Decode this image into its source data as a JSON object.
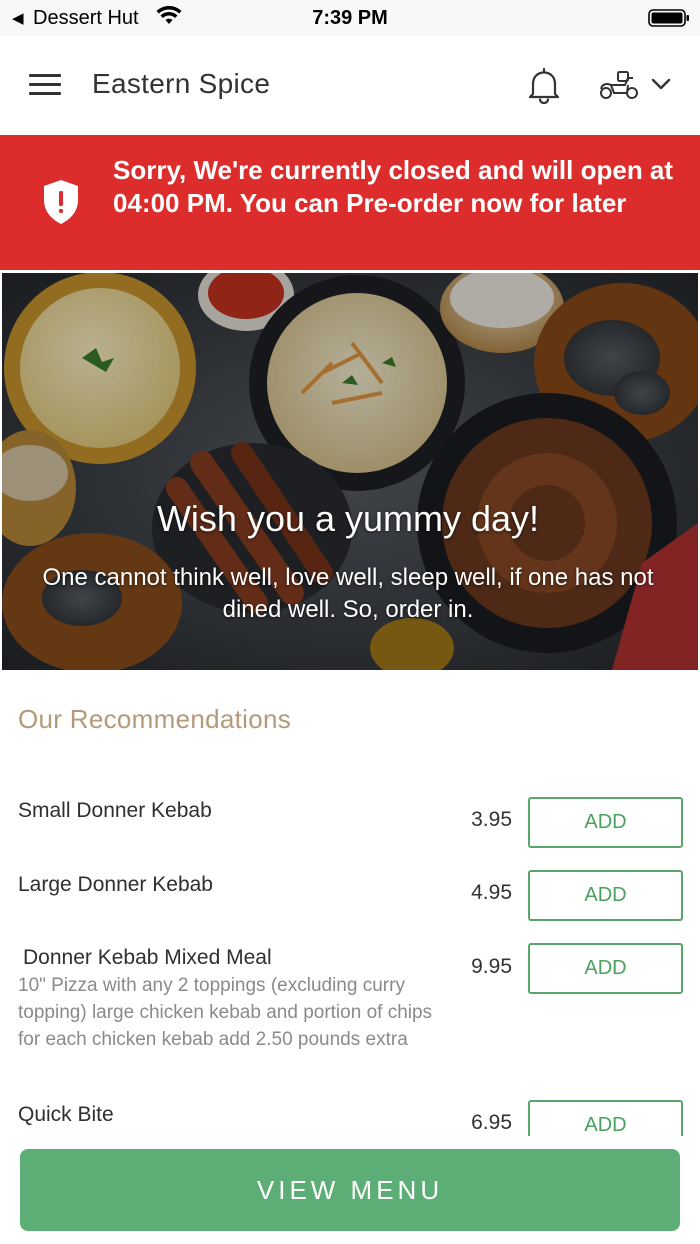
{
  "status_bar": {
    "back_arrow": "◀",
    "app_name": "Dessert Hut",
    "time": "7:39 PM",
    "icons": [
      "wifi-icon",
      "battery-icon"
    ]
  },
  "header": {
    "restaurant_name": "Eastern Spice",
    "icons": [
      "menu-icon",
      "bell-icon",
      "delivery-scooter-icon",
      "chevron-down-icon"
    ]
  },
  "closed_banner": {
    "message": "Sorry, We're currently closed and will open at 04:00 PM. You can Pre-order now for later",
    "icon": "shield-alert-icon",
    "color": "#dc2c2c"
  },
  "hero": {
    "title": "Wish you a yummy day!",
    "subtitle": "One cannot think well, love well, sleep well, if one has not dined well. So, order in."
  },
  "recommendations": {
    "heading": "Our Recommendations",
    "add_label": "ADD",
    "items": [
      {
        "name": "Small Donner Kebab",
        "price": "3.95",
        "description": ""
      },
      {
        "name": "Large Donner Kebab",
        "price": "4.95",
        "description": ""
      },
      {
        "name": "Donner Kebab Mixed Meal",
        "price": "9.95",
        "description": "10\" Pizza with any 2 toppings (excluding curry topping) large chicken kebab and portion of chips for each chicken kebab add 2.50 pounds extra"
      },
      {
        "name": "Quick Bite",
        "price": "6.95",
        "description": ""
      }
    ]
  },
  "view_menu": {
    "label": "VIEW MENU"
  },
  "colors": {
    "accent_green": "#5cae76",
    "heading_tan": "#b49a78",
    "banner_red": "#dc2c2c"
  }
}
